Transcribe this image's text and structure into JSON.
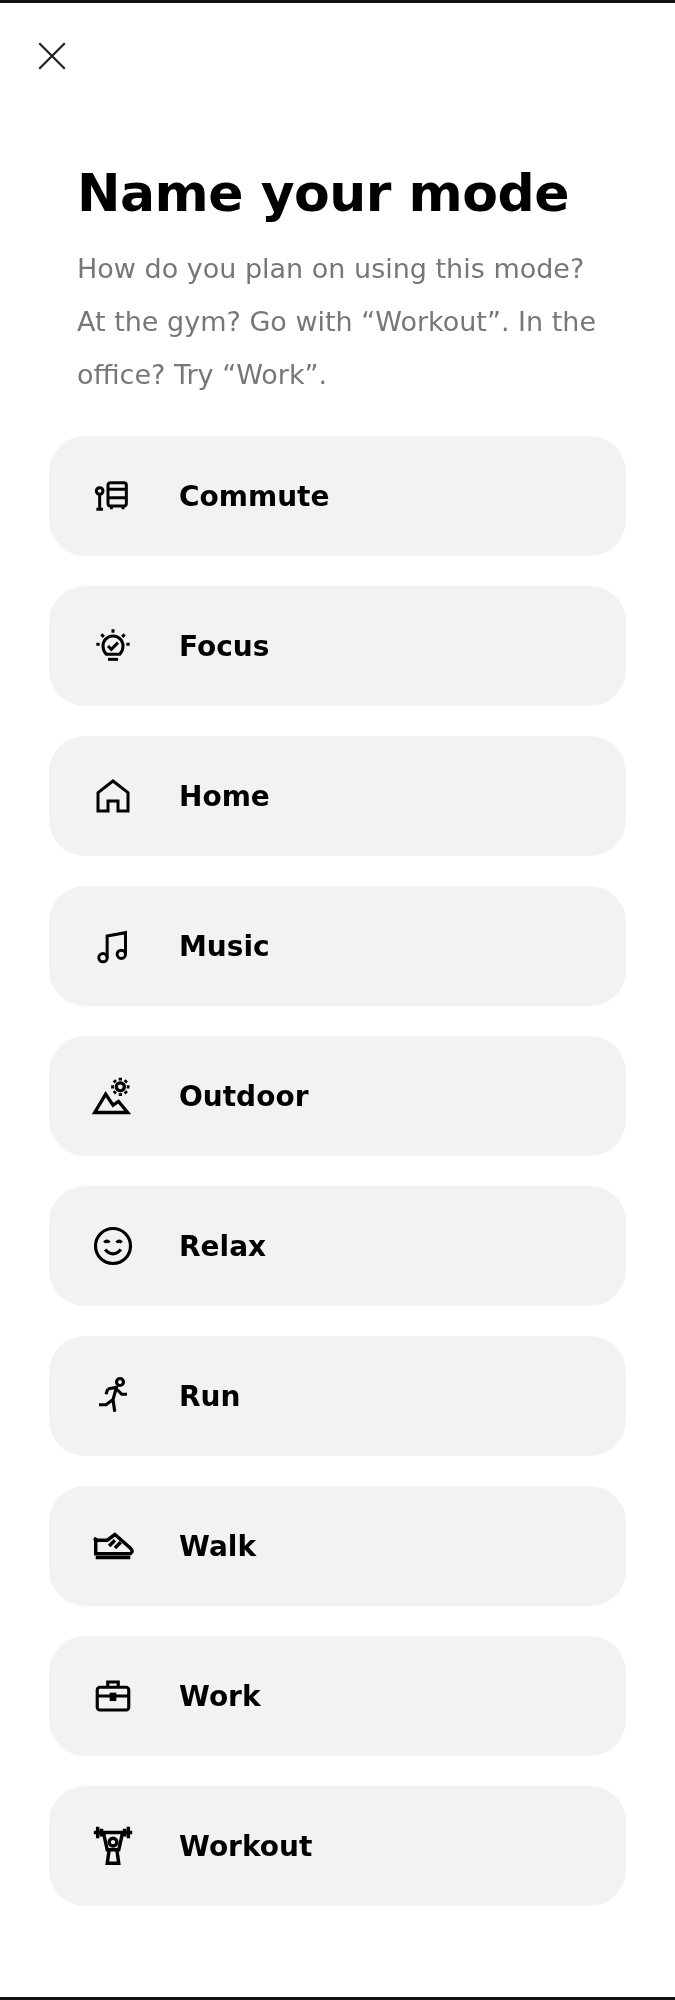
{
  "title": "Name your mode",
  "description": "How do you plan on using this mode? At the gym? Go with “Workout”. In the office? Try “Work”.",
  "modes": [
    {
      "label": "Commute"
    },
    {
      "label": "Focus"
    },
    {
      "label": "Home"
    },
    {
      "label": "Music"
    },
    {
      "label": "Outdoor"
    },
    {
      "label": "Relax"
    },
    {
      "label": "Run"
    },
    {
      "label": "Walk"
    },
    {
      "label": "Work"
    },
    {
      "label": "Workout"
    }
  ]
}
